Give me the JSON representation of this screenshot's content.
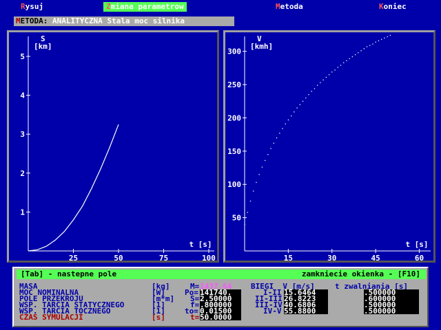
{
  "menu": [
    {
      "hk": "R",
      "rest": "ysuj",
      "active": false
    },
    {
      "hk": "Z",
      "rest": "miana parametrow",
      "active": true
    },
    {
      "hk": "M",
      "rest": "etoda",
      "active": false
    },
    {
      "hk": "K",
      "rest": "oniec",
      "active": false
    }
  ],
  "method": {
    "hk": "M",
    "label": "ETODA:",
    "value": " ANALITYCZNA Stala moc silnika"
  },
  "chart_data": [
    {
      "type": "line",
      "ylabel": "S",
      "yunit": "[km]",
      "xlabel": "t [s]",
      "xlim": [
        0,
        100
      ],
      "ylim": [
        0,
        5.3
      ],
      "xticks": [
        25,
        50,
        75,
        100
      ],
      "yticks": [
        1,
        2,
        3,
        4,
        5
      ],
      "x": [
        0,
        5,
        10,
        15,
        20,
        25,
        30,
        35,
        40,
        45,
        50
      ],
      "y": [
        0,
        0.03,
        0.12,
        0.28,
        0.5,
        0.8,
        1.15,
        1.6,
        2.1,
        2.65,
        3.25
      ]
    },
    {
      "type": "scatter",
      "ylabel": "V",
      "yunit": "[kmh]",
      "xlabel": "t [s]",
      "xlim": [
        0,
        62
      ],
      "ylim": [
        0,
        310
      ],
      "xticks": [
        15,
        30,
        45,
        60
      ],
      "yticks": [
        50,
        100,
        150,
        200,
        250,
        300
      ],
      "x": [
        0,
        1,
        2,
        3,
        4,
        5,
        6,
        7,
        8,
        9,
        10,
        11,
        12,
        13,
        14,
        15,
        16,
        17,
        18,
        19,
        20,
        21,
        22,
        23,
        24,
        25,
        26,
        27,
        28,
        29,
        30,
        31,
        32,
        33,
        34,
        35,
        36,
        37,
        38,
        39,
        40,
        41,
        42,
        43,
        44,
        45,
        46,
        47,
        48,
        49,
        50
      ],
      "y": [
        40,
        58,
        75,
        90,
        103,
        115,
        126,
        136,
        145,
        154,
        162,
        170,
        177,
        184,
        191,
        197,
        203,
        209,
        215,
        220,
        225,
        230,
        235,
        240,
        244,
        249,
        253,
        257,
        261,
        265,
        269,
        272,
        276,
        279,
        283,
        286,
        289,
        292,
        295,
        298,
        301,
        304,
        307,
        309,
        311,
        314,
        316,
        318,
        320,
        322,
        324
      ]
    }
  ],
  "panel": {
    "header_left": "[Tab] - nastepne pole",
    "header_right": "zamkniecie okienka - [F10]",
    "rows": [
      {
        "label": "MASA",
        "unit": "[kg]",
        "sym": "M=",
        "value": "1437.64",
        "color": "blue",
        "hl": true
      },
      {
        "label": "MOC NOMINALNA",
        "unit": "[W]",
        "sym": "Po=",
        "value": "141740.",
        "color": "blue",
        "hl": false
      },
      {
        "label": "POLE PRZEKROJU",
        "unit": "[m*m]",
        "sym": "S=",
        "value": "2.50000",
        "color": "blue",
        "hl": false
      },
      {
        "label": "WSP. TARCIA STATYCZNEGO",
        "unit": "[1]",
        "sym": "f=",
        "value": ".800000",
        "color": "blue",
        "hl": false
      },
      {
        "label": "WSP. TARCIA TOCZNEGO",
        "unit": "[1]",
        "sym": "to=",
        "value": "0.01500",
        "color": "blue",
        "hl": false
      },
      {
        "label": "CZAS SYMULACJI",
        "unit": "[s]",
        "sym": "t=",
        "value": "50.0000",
        "color": "red",
        "hl": false
      }
    ],
    "gear_header": "BIEGI  V [m/s]",
    "t_header": "t zwalniania [s]",
    "gears": [
      {
        "name": "I-II",
        "v": "15.6464",
        "t": ".500000"
      },
      {
        "name": "II-III",
        "v": "26.8223",
        "t": ".600000"
      },
      {
        "name": "III-IV",
        "v": "40.6806",
        "t": ".500000"
      },
      {
        "name": "IV-V",
        "v": "55.8800",
        "t": ".500000"
      }
    ]
  }
}
